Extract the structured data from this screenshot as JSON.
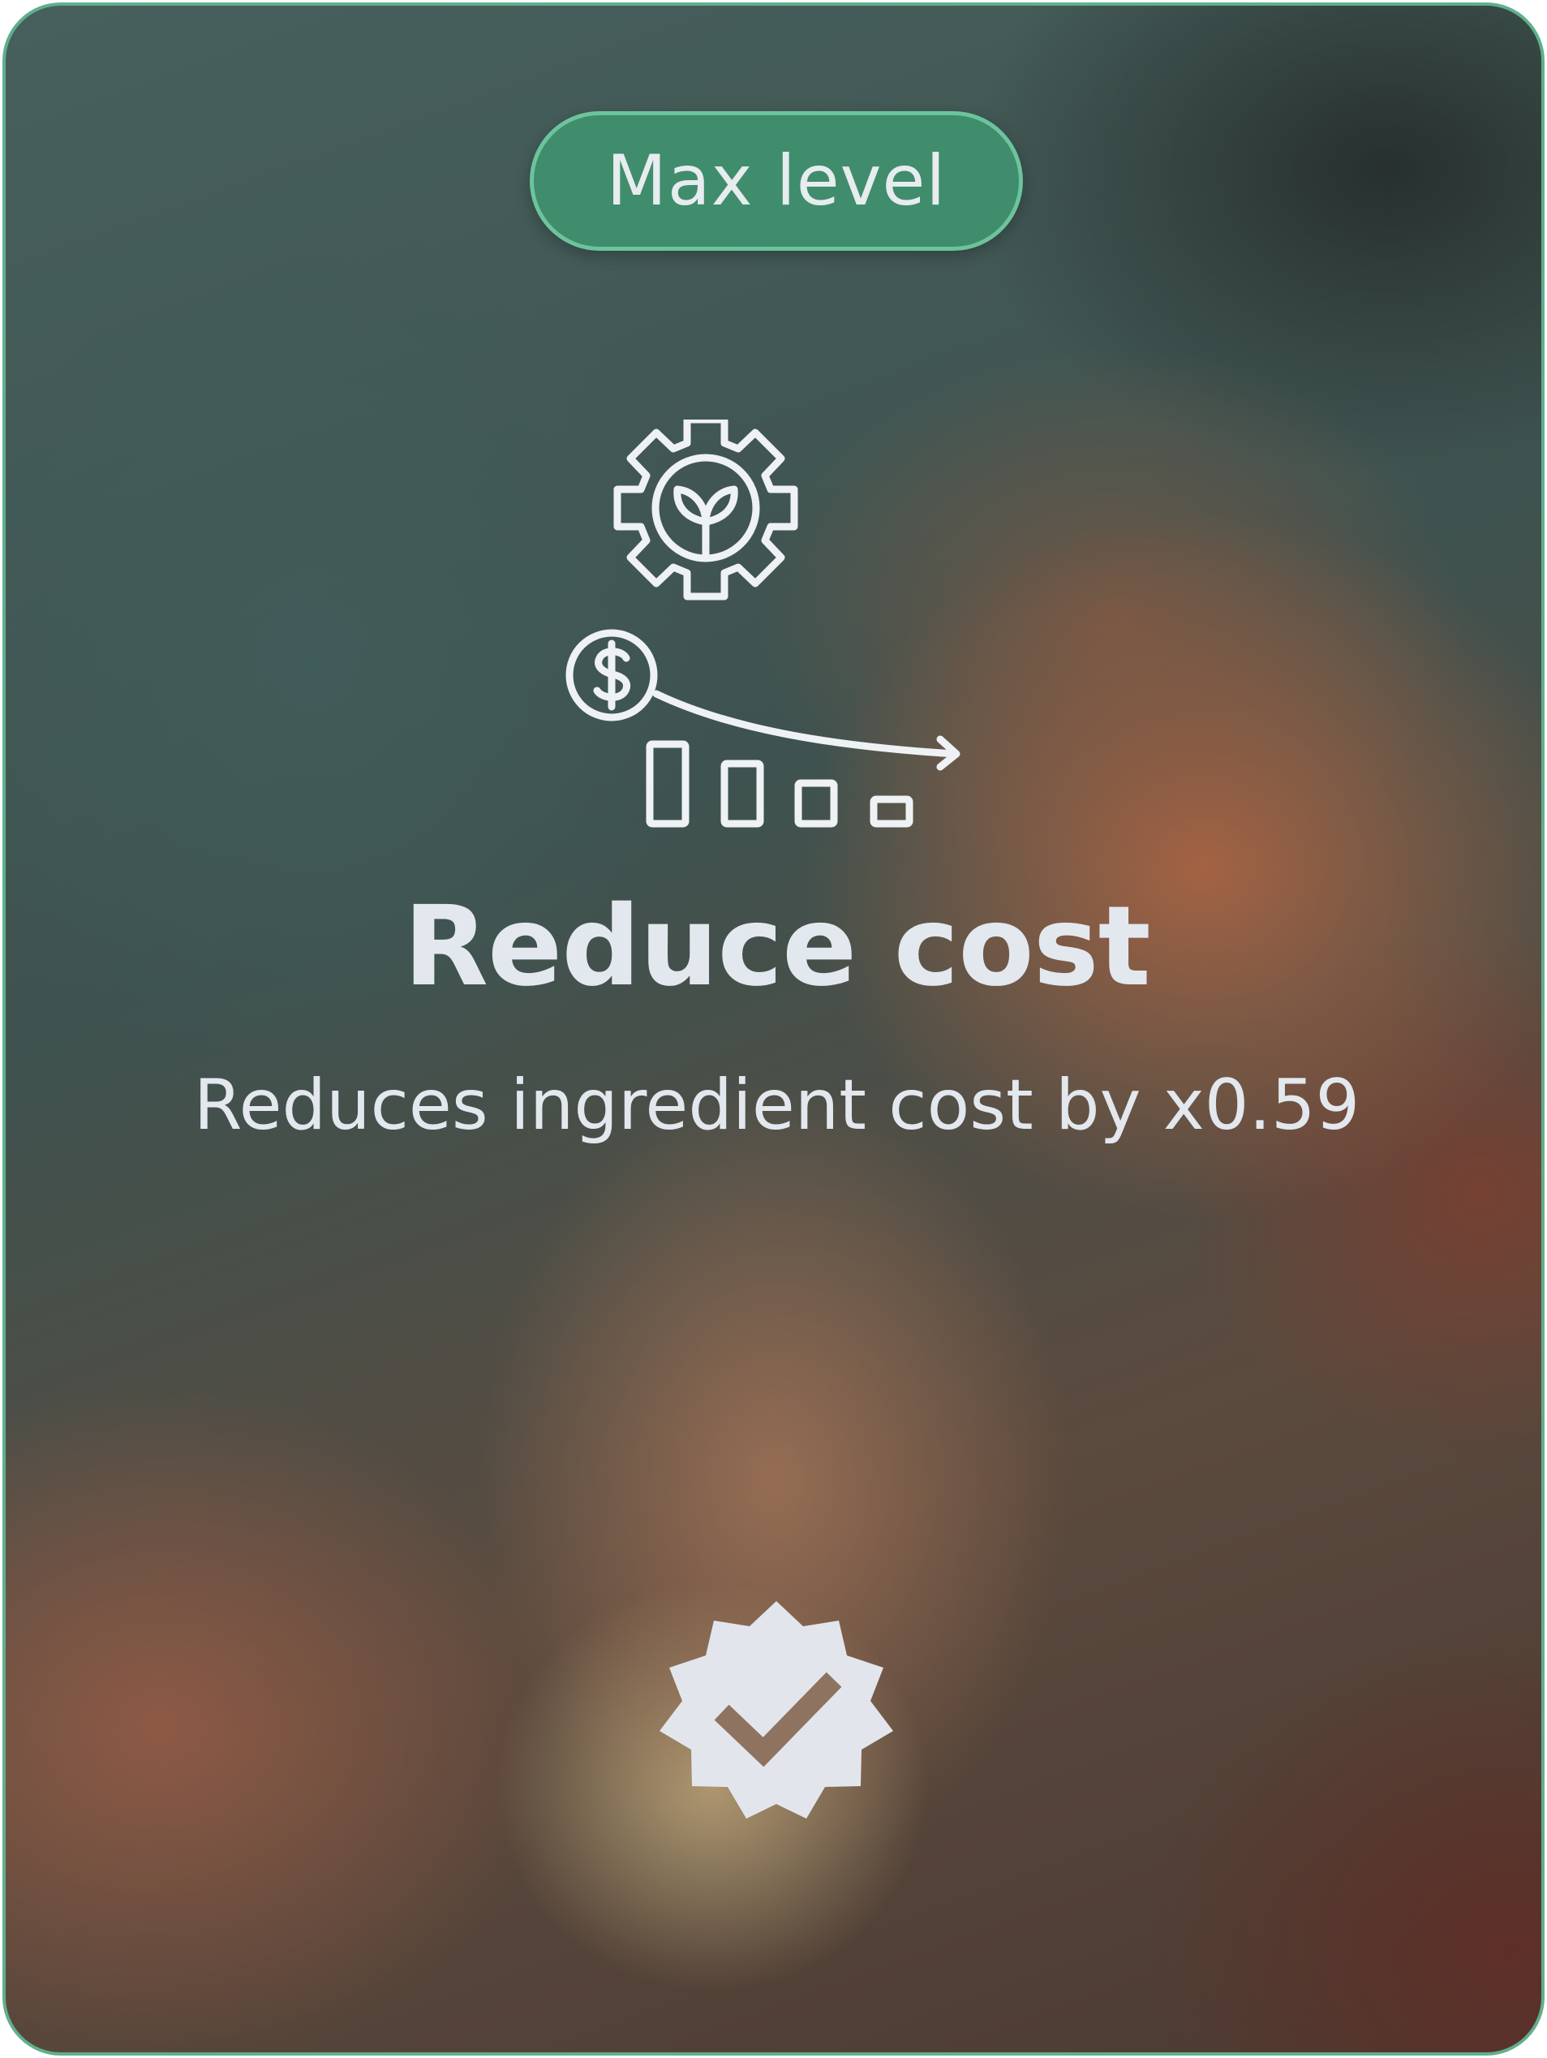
{
  "card": {
    "badge_label": "Max level",
    "title": "Reduce cost",
    "description": "Reduces ingredient cost by x0.59",
    "main_icon": "gear-sprout-cost-reduction-icon",
    "status_icon": "verified-check-badge-icon"
  },
  "colors": {
    "border": "#5fb08c",
    "badge_bg": "#3f8d6c",
    "text": "#e3e8ee"
  }
}
